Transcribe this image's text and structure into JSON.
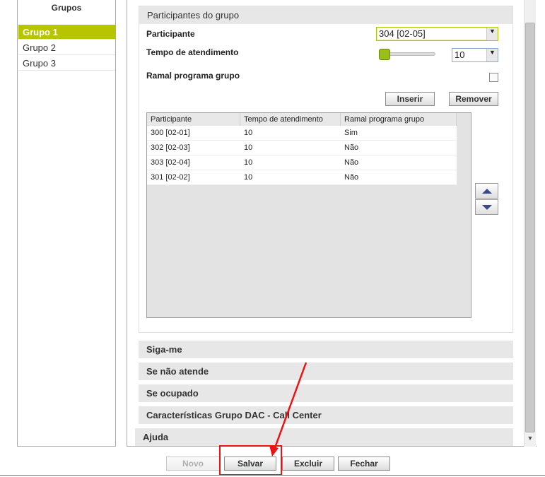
{
  "groups": {
    "title": "Grupos",
    "items": [
      {
        "label": "Grupo 1"
      },
      {
        "label": "Grupo 2"
      },
      {
        "label": "Grupo 3"
      }
    ]
  },
  "participants_section": {
    "title": "Participantes do grupo",
    "participant_label": "Participante",
    "participant_value": "304 [02-05]",
    "time_label": "Tempo de atendimento",
    "time_value": "10",
    "ramal_label": "Ramal programa grupo",
    "ramal_checked": false,
    "insert_button": "Inserir",
    "remove_button": "Remover",
    "table": {
      "columns": [
        "Participante",
        "Tempo de atendimento",
        "Ramal programa grupo"
      ],
      "rows": [
        [
          "300 [02-01]",
          "10",
          "Sim"
        ],
        [
          "302 [02-03]",
          "10",
          "Não"
        ],
        [
          "303 [02-04]",
          "10",
          "Não"
        ],
        [
          "301 [02-02]",
          "10",
          "Não"
        ]
      ]
    }
  },
  "collapsed_sections": [
    {
      "title": "Siga-me"
    },
    {
      "title": "Se não atende"
    },
    {
      "title": "Se ocupado"
    },
    {
      "title": "Características Grupo DAC - Call Center"
    },
    {
      "title": "Ajuda"
    }
  ],
  "footer_buttons": {
    "novo": "Novo",
    "salvar": "Salvar",
    "excluir": "Excluir",
    "fechar": "Fechar"
  },
  "colors": {
    "accent": "#b6c500",
    "annotation": "#ee1111"
  }
}
